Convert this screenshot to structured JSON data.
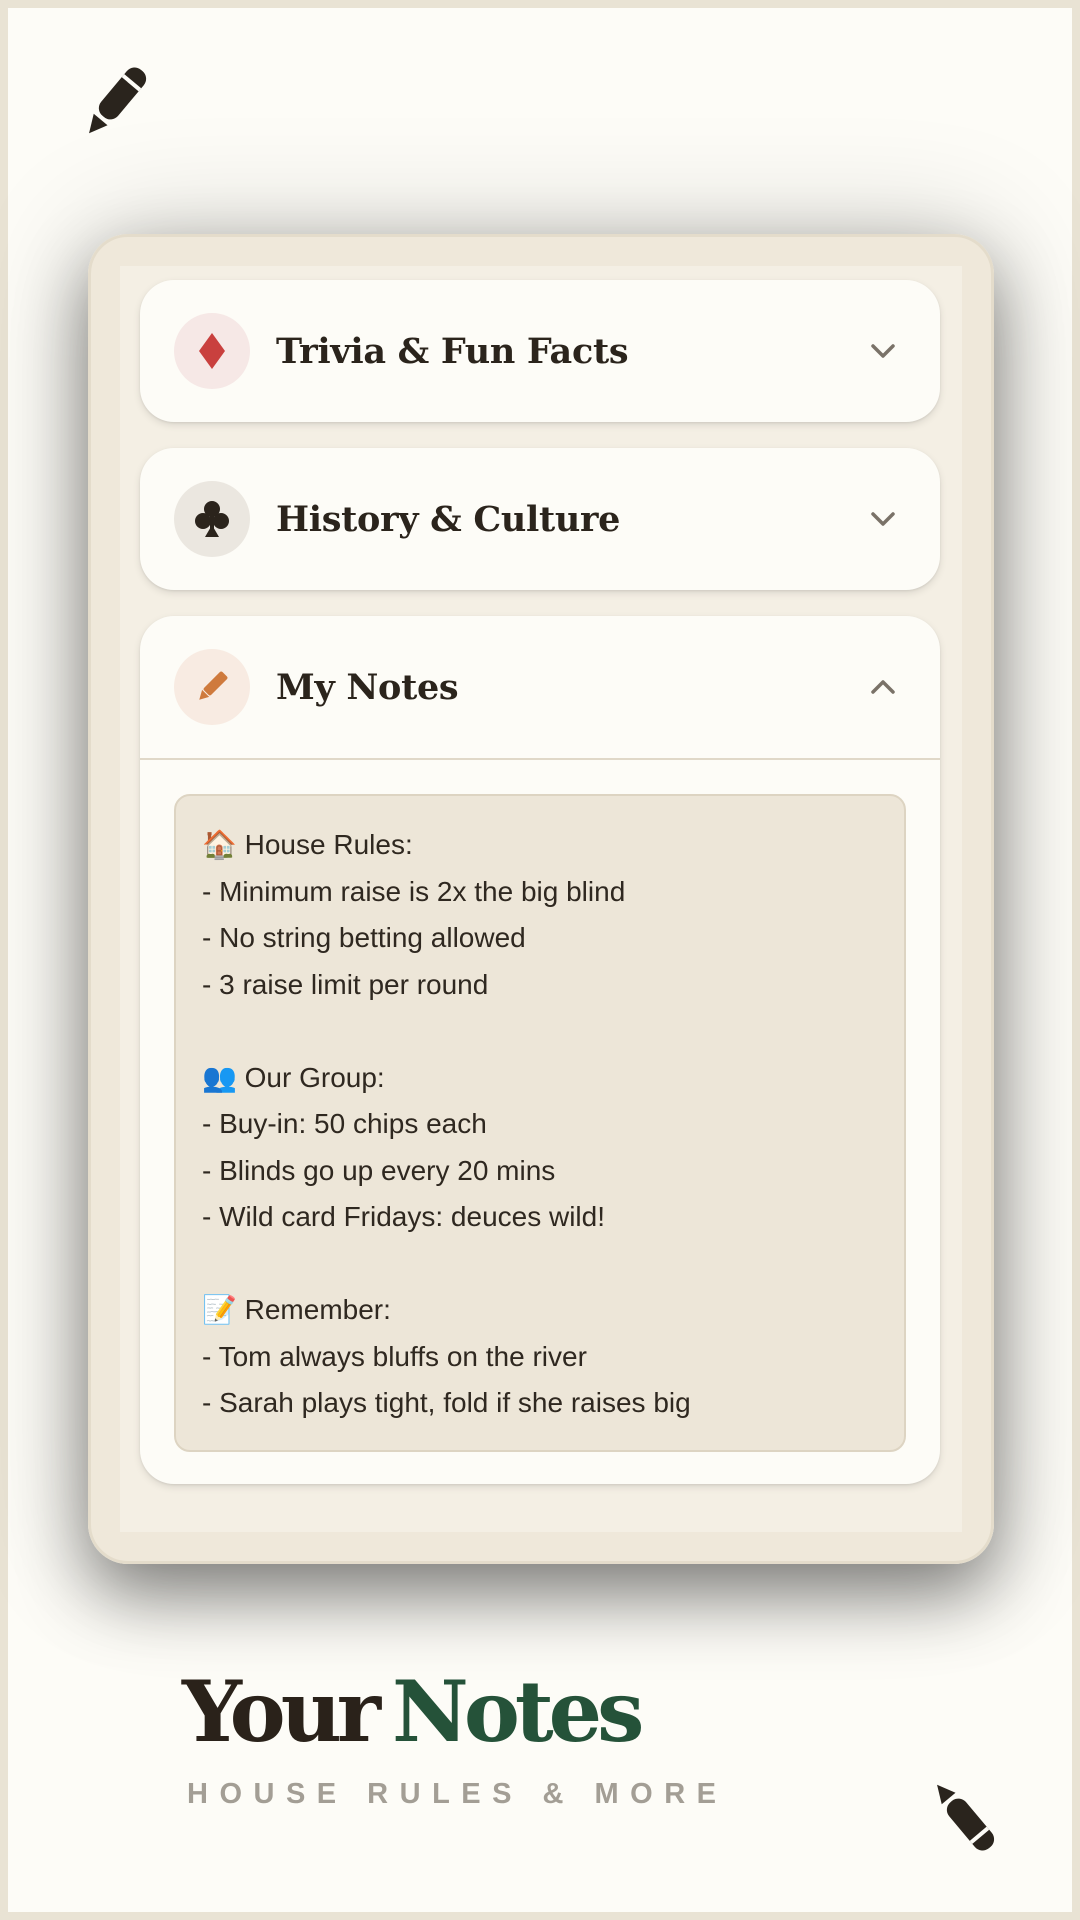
{
  "sections": [
    {
      "title": "Trivia & Fun Facts",
      "icon": "diamond-icon",
      "icon_color": "#c9403e",
      "icon_bg": "#f6e8e6",
      "expanded": false
    },
    {
      "title": "History & Culture",
      "icon": "club-icon",
      "icon_color": "#2b241c",
      "icon_bg": "#ebe7e0",
      "expanded": false
    },
    {
      "title": "My Notes",
      "icon": "pencil-icon",
      "icon_color": "#cf7a3d",
      "icon_bg": "#f8ebe2",
      "expanded": true
    }
  ],
  "notes": {
    "lines": [
      "🏠 House Rules:",
      "- Minimum raise is 2x the big blind",
      "- No string betting allowed",
      "- 3 raise limit per round",
      "",
      "👥 Our Group:",
      "- Buy-in: 50 chips each",
      "- Blinds go up every 20 mins",
      "- Wild card Fridays: deuces wild!",
      "",
      "📝 Remember:",
      "- Tom always bluffs on the river",
      "- Sarah plays tight, fold if she raises big"
    ]
  },
  "brand": {
    "word1": "Your",
    "word2": "Notes",
    "tagline": "HOUSE RULES & MORE",
    "colors": {
      "word1": "#2a221a",
      "word2": "#255239",
      "tagline": "#a39e95"
    }
  }
}
